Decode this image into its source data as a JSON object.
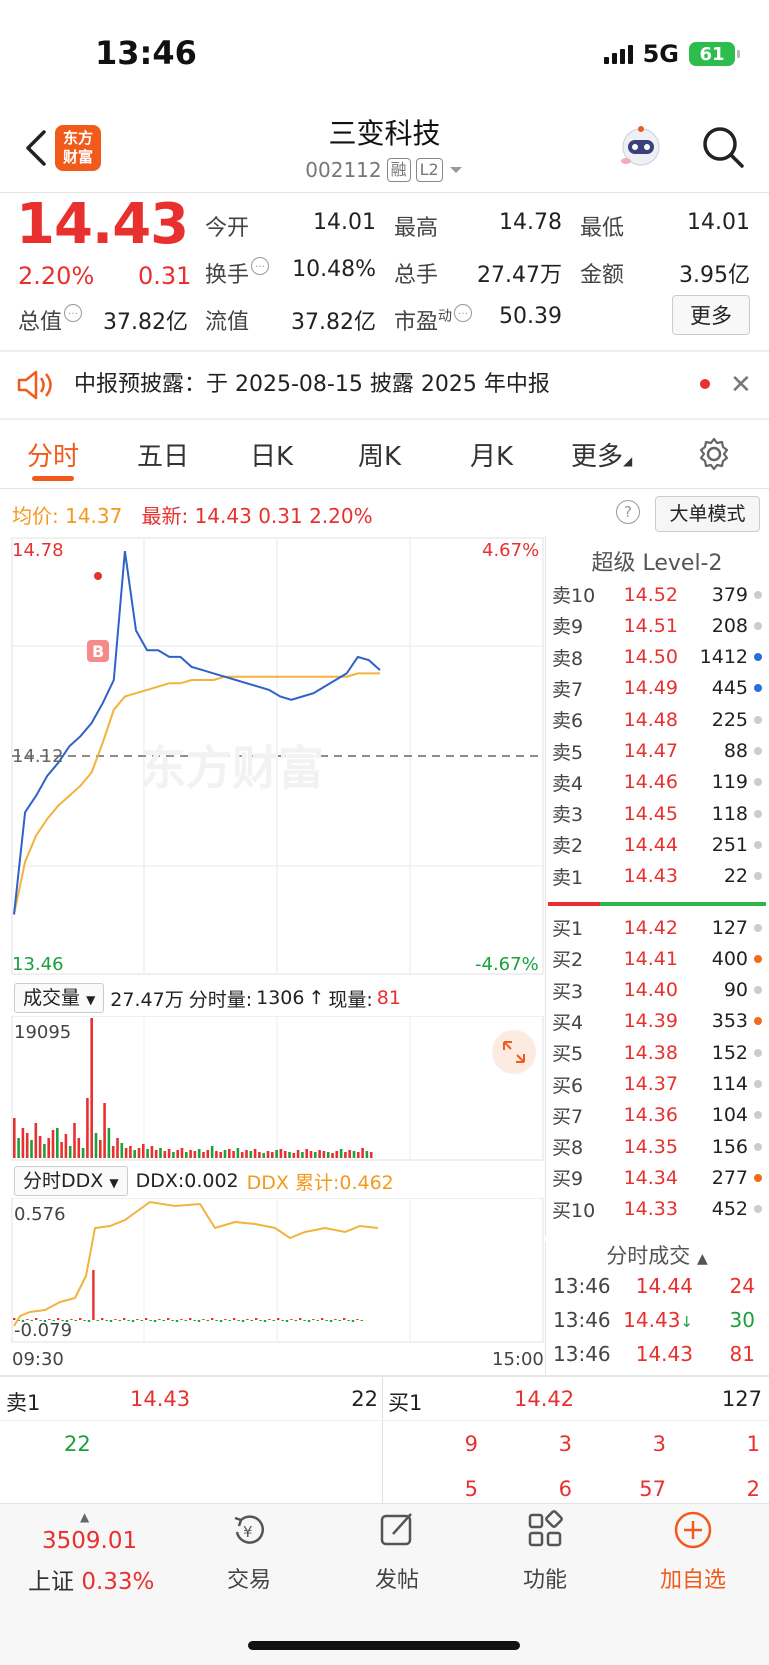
{
  "status_bar": {
    "time": "13:46",
    "network": "5G",
    "battery": "61"
  },
  "header": {
    "stock_name": "三变科技",
    "stock_code": "002112",
    "tag_margin": "融",
    "tag_level": "L2",
    "logo_line1": "东方",
    "logo_line2": "财富"
  },
  "quote": {
    "price": "14.43",
    "change_pct": "2.20%",
    "change": "0.31",
    "fields": [
      {
        "label": "今开",
        "value": "14.01"
      },
      {
        "label": "最高",
        "value": "14.78"
      },
      {
        "label": "最低",
        "value": "14.01"
      },
      {
        "label": "换手",
        "value": "10.48%"
      },
      {
        "label": "总手",
        "value": "27.47万"
      },
      {
        "label": "金额",
        "value": "3.95亿"
      },
      {
        "label": "总值",
        "value": "37.82亿"
      },
      {
        "label": "流值",
        "value": "37.82亿"
      },
      {
        "label": "市盈",
        "value": "50.39"
      }
    ],
    "pe_sup": "动",
    "more_label": "更多"
  },
  "notice": {
    "text": "中报预披露：于 2025-08-15 披露 2025 年中报"
  },
  "tabs": [
    "分时",
    "五日",
    "日K",
    "周K",
    "月K",
    "更多"
  ],
  "chart_header": {
    "avg_label": "均价:",
    "avg_value": "14.37",
    "latest_label": "最新:",
    "latest_value": "14.43",
    "latest_chg": "0.31",
    "latest_pct": "2.20%",
    "mode_label": "大单模式"
  },
  "chart_data": {
    "type": "line",
    "y_max": "14.78",
    "y_min": "13.46",
    "y_pre_close": "14.12",
    "pct_max": "4.67%",
    "pct_min": "-4.67%",
    "x_start": "09:30",
    "x_end": "15:00",
    "watermark": "东方财富",
    "marker_label": "B",
    "price_series": [
      13.64,
      13.95,
      14.0,
      14.06,
      14.1,
      14.15,
      14.18,
      14.22,
      14.28,
      14.35,
      14.74,
      14.5,
      14.44,
      14.44,
      14.42,
      14.42,
      14.39,
      14.38,
      14.37,
      14.36,
      14.35,
      14.34,
      14.33,
      14.32,
      14.3,
      14.29,
      14.3,
      14.31,
      14.33,
      14.35,
      14.37,
      14.42,
      14.41,
      14.38
    ],
    "avg_series": [
      13.64,
      13.8,
      13.88,
      13.93,
      13.97,
      14.0,
      14.03,
      14.07,
      14.16,
      14.26,
      14.3,
      14.31,
      14.32,
      14.33,
      14.34,
      14.34,
      14.35,
      14.35,
      14.35,
      14.36,
      14.36,
      14.36,
      14.36,
      14.36,
      14.36,
      14.36,
      14.36,
      14.36,
      14.36,
      14.36,
      14.36,
      14.37,
      14.37,
      14.37
    ],
    "volume": {
      "label": "成交量",
      "total": "27.47万",
      "period_label": "分时量:",
      "period_value": "1306",
      "now_label": "现量:",
      "now_value": "81",
      "max_label": "19095"
    },
    "ddx": {
      "label": "分时DDX",
      "value_text": "DDX:0.002",
      "cum_text": "DDX 累计:0.462",
      "max_label": "0.576",
      "min_label": "-0.079"
    }
  },
  "order_book": {
    "title": "超级 Level-2",
    "asks": [
      {
        "label": "卖10",
        "price": "14.52",
        "vol": "379",
        "dot": "#cccccc"
      },
      {
        "label": "卖9",
        "price": "14.51",
        "vol": "208",
        "dot": "#cccccc"
      },
      {
        "label": "卖8",
        "price": "14.50",
        "vol": "1412",
        "dot": "#2a6fd6"
      },
      {
        "label": "卖7",
        "price": "14.49",
        "vol": "445",
        "dot": "#2a6fd6"
      },
      {
        "label": "卖6",
        "price": "14.48",
        "vol": "225",
        "dot": "#cccccc"
      },
      {
        "label": "卖5",
        "price": "14.47",
        "vol": "88",
        "dot": "#cccccc"
      },
      {
        "label": "卖4",
        "price": "14.46",
        "vol": "119",
        "dot": "#cccccc"
      },
      {
        "label": "卖3",
        "price": "14.45",
        "vol": "118",
        "dot": "#cccccc"
      },
      {
        "label": "卖2",
        "price": "14.44",
        "vol": "251",
        "dot": "#cccccc"
      },
      {
        "label": "卖1",
        "price": "14.43",
        "vol": "22",
        "dot": "#cccccc"
      }
    ],
    "bids": [
      {
        "label": "买1",
        "price": "14.42",
        "vol": "127",
        "dot": "#cccccc"
      },
      {
        "label": "买2",
        "price": "14.41",
        "vol": "400",
        "dot": "#ef6c1a"
      },
      {
        "label": "买3",
        "price": "14.40",
        "vol": "90",
        "dot": "#cccccc"
      },
      {
        "label": "买4",
        "price": "14.39",
        "vol": "353",
        "dot": "#ef6c1a"
      },
      {
        "label": "买5",
        "price": "14.38",
        "vol": "152",
        "dot": "#cccccc"
      },
      {
        "label": "买6",
        "price": "14.37",
        "vol": "114",
        "dot": "#cccccc"
      },
      {
        "label": "买7",
        "price": "14.36",
        "vol": "104",
        "dot": "#cccccc"
      },
      {
        "label": "买8",
        "price": "14.35",
        "vol": "156",
        "dot": "#cccccc"
      },
      {
        "label": "买9",
        "price": "14.34",
        "vol": "277",
        "dot": "#ef6c1a"
      },
      {
        "label": "买10",
        "price": "14.33",
        "vol": "452",
        "dot": "#cccccc"
      }
    ],
    "trades_title": "分时成交",
    "trades": [
      {
        "time": "13:46",
        "price": "14.44",
        "vol": "24",
        "vol_color": "red",
        "arrow": ""
      },
      {
        "time": "13:46",
        "price": "14.43",
        "vol": "30",
        "vol_color": "green",
        "arrow": "↓"
      },
      {
        "time": "13:46",
        "price": "14.43",
        "vol": "81",
        "vol_color": "red",
        "arrow": ""
      }
    ]
  },
  "queue": {
    "ask_label": "卖1",
    "ask_price": "14.43",
    "ask_vol": "22",
    "bid_label": "买1",
    "bid_price": "14.42",
    "bid_vol": "127",
    "ask_orders": [
      "22"
    ],
    "bid_orders_row1": [
      "9",
      "3",
      "3",
      "1"
    ],
    "bid_orders_row2": [
      "5",
      "6",
      "57",
      "2"
    ]
  },
  "index": {
    "value": "3509.01",
    "name": "上证",
    "pct": "0.33%"
  },
  "bottom_nav": [
    "交易",
    "发帖",
    "功能",
    "加自选"
  ]
}
